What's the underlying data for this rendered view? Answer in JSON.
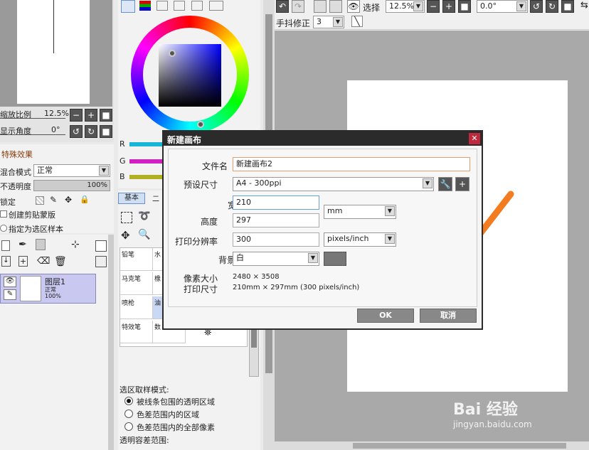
{
  "navigator": {
    "zoom_label": "缩放比例",
    "zoom_value": "12.5%",
    "angle_label": "显示角度",
    "angle_value": "0°"
  },
  "effects": {
    "title": "特殊效果"
  },
  "layer_props": {
    "blend_label": "混合模式",
    "blend_value": "正常",
    "opacity_label": "不透明度",
    "opacity_value": "100%",
    "lock_label": "锁定",
    "clip_label": "创建剪贴蒙版",
    "selection_source_label": "指定为选区样本"
  },
  "layer": {
    "name": "图层1",
    "mode": "正常",
    "opacity": "100%"
  },
  "color": {
    "r_label": "R",
    "g_label": "G",
    "b_label": "B"
  },
  "tool_tabs": {
    "basic": "基本",
    "second": "二"
  },
  "tool_cells": [
    "铅笔",
    "马克笔",
    "喷枪",
    "特效笔"
  ],
  "tool_cells_b": [
    "水",
    "橡",
    "油",
    "数"
  ],
  "selection_mode": {
    "title": "选区取样模式:",
    "opt1": "被线条包围的透明区域",
    "opt2": "色差范围内的区域",
    "opt3": "色差范围内的全部像素",
    "tolerance": "透明容差范围:"
  },
  "toolbar": {
    "select_label": "选择",
    "zoom": "12.5%",
    "angle": "0.0°",
    "stabilizer_label": "手抖修正",
    "stabilizer_value": "3"
  },
  "dialog": {
    "title": "新建画布",
    "filename_label": "文件名",
    "filename_value": "新建画布2",
    "preset_label": "预设尺寸",
    "preset_value": "A4 - 300ppi",
    "width_label": "宽",
    "width_value": "210",
    "height_label": "高度",
    "height_value": "297",
    "unit_value": "mm",
    "dpi_label": "打印分辨率",
    "dpi_value": "300",
    "dpi_unit": "pixels/inch",
    "bg_label": "背景",
    "bg_value": "白",
    "pixel_size_label": "像素大小",
    "pixel_size_value": "2480 × 3508",
    "print_size_label": "打印尺寸",
    "print_size_value": "210mm × 297mm (300 pixels/inch)",
    "ok": "OK",
    "cancel": "取消"
  },
  "watermark": {
    "brand": "Bai 经验",
    "url": "jingyan.baidu.com"
  },
  "colors": {
    "dialog_title_bg": "#2b2b2b",
    "arrow": "#f47c20",
    "canvas_bg": "#a9a9a9"
  }
}
